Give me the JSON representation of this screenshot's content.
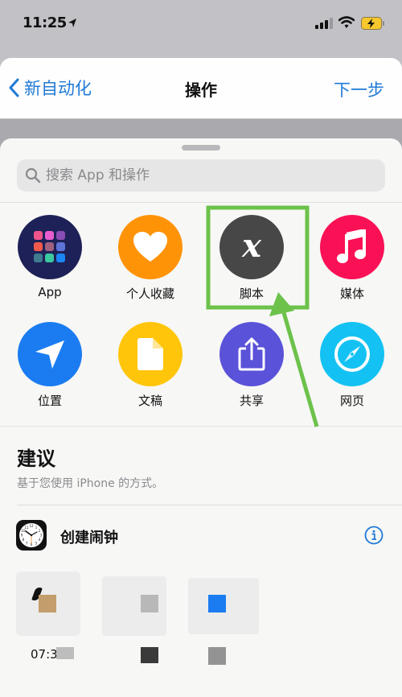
{
  "status_bar": {
    "time": "11:25",
    "icons": [
      "location-arrow-icon",
      "cellular-signal-icon",
      "wifi-icon",
      "battery-charging-icon"
    ]
  },
  "nav": {
    "back_label": "新自动化",
    "title": "操作",
    "next_label": "下一步"
  },
  "search": {
    "placeholder": "搜索 App 和操作",
    "value": ""
  },
  "categories": [
    {
      "label": "App",
      "icon": "apps-grid-icon",
      "color": "#1e2157"
    },
    {
      "label": "个人收藏",
      "icon": "heart-icon",
      "color": "#ff9308"
    },
    {
      "label": "脚本",
      "icon": "script-x-icon",
      "color": "#474747"
    },
    {
      "label": "媒体",
      "icon": "music-note-icon",
      "color": "#fa1155"
    },
    {
      "label": "位置",
      "icon": "location-arrow-icon",
      "color": "#1a7cf0"
    },
    {
      "label": "文稿",
      "icon": "document-icon",
      "color": "#ffc50a"
    },
    {
      "label": "共享",
      "icon": "share-icon",
      "color": "#5a52d8"
    },
    {
      "label": "网页",
      "icon": "compass-icon",
      "color": "#13c2f2"
    }
  ],
  "suggestions": {
    "title": "建议",
    "subtitle": "基于您使用 iPhone 的方式。",
    "items": [
      {
        "label": "创建闹钟",
        "icon": "clock-icon"
      }
    ],
    "pixelated_caption": "07:30"
  },
  "annotation": {
    "highlighted": "脚本",
    "color": "#6cc24a"
  },
  "colors": {
    "accent": "#1f7ad6",
    "sheet_bg": "#f7f7f6",
    "backdrop": "#c2c1c6"
  }
}
